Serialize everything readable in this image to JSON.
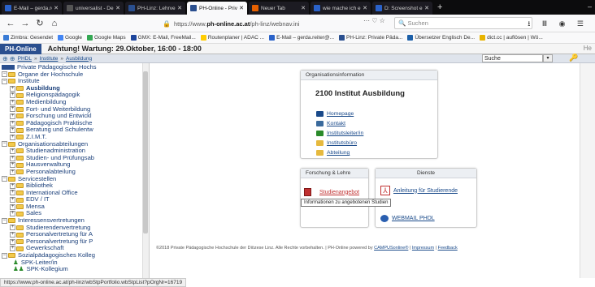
{
  "browser": {
    "tabs": [
      {
        "title": "E-Mail – gerda.reit",
        "color": "#2a62c9",
        "active": false
      },
      {
        "title": "universalist - Deuts",
        "color": "#555",
        "active": false
      },
      {
        "title": "PH-Linz: Lehrveran",
        "color": "#2a4f8f",
        "active": false
      },
      {
        "title": "PH-Online - Private",
        "color": "#2a4f8f",
        "active": true
      },
      {
        "title": "Neuer Tab",
        "color": "#e66000",
        "active": false
      },
      {
        "title": "wie mache ich einen",
        "color": "#2a62c9",
        "active": false
      },
      {
        "title": "D: Screenshot erstel",
        "color": "#2a62c9",
        "active": false
      }
    ],
    "url_prefix": "https://www.",
    "url_domain": "ph-online.ac.at",
    "url_path": "/ph-linz/webnav.ini",
    "url_more": "···",
    "search_placeholder": "Suchen",
    "bookmarks": [
      {
        "label": "Zimbra: Gesendet",
        "color": "#3a7bd5"
      },
      {
        "label": "Google",
        "color": "#4285f4"
      },
      {
        "label": "Google Maps",
        "color": "#34a853"
      },
      {
        "label": "GMX: E-Mail, FreeMail...",
        "color": "#1c449b"
      },
      {
        "label": "Routenplaner | ADAC ...",
        "color": "#ffcc00"
      },
      {
        "label": "E-Mail – gerda.reiter@...",
        "color": "#2a62c9"
      },
      {
        "label": "PH-Linz: Private Päda...",
        "color": "#2a4f8f"
      },
      {
        "label": "Übersetzer Englisch De...",
        "color": "#1c5fa8"
      },
      {
        "label": "dict.cc | auflösen | Wö...",
        "color": "#e8b400"
      }
    ],
    "status_url": "https://www.ph-online.ac.at/ph-linz/wbStpPortfolio.wbStpList?pOrgNr=16719"
  },
  "phonline": {
    "logo": "PH-Online",
    "warning_bold": "Achtung!",
    "warning_text": " Wartung: 29.Oktober, 16:00 - 18:00",
    "right_text": "He",
    "breadcrumb": [
      "PHDL",
      "Institute",
      "Ausbildung"
    ],
    "search_label": "Suche"
  },
  "tree": [
    {
      "label": "Private Pädagogische Hochs",
      "level": 0,
      "icon": "logo"
    },
    {
      "label": "Organe der Hochschule",
      "level": 1
    },
    {
      "label": "Institute",
      "level": 1
    },
    {
      "label": "Ausbildung",
      "level": 2,
      "bold": true
    },
    {
      "label": "Religionspädagogik",
      "level": 2
    },
    {
      "label": "Medienbildung",
      "level": 2
    },
    {
      "label": "Fort- und Weiterbildung",
      "level": 2
    },
    {
      "label": "Forschung und Entwickl",
      "level": 2
    },
    {
      "label": "Pädagogisch Praktische",
      "level": 2
    },
    {
      "label": "Beratung und Schulentw",
      "level": 2
    },
    {
      "label": "Z.I.M.T.",
      "level": 2
    },
    {
      "label": "Organisationsabteilungen",
      "level": 1
    },
    {
      "label": "Studienadministration",
      "level": 2
    },
    {
      "label": "Studien- und Prüfungsab",
      "level": 2
    },
    {
      "label": "Hausverwaltung",
      "level": 2
    },
    {
      "label": "Personalabteilung",
      "level": 2
    },
    {
      "label": "Servicestellen",
      "level": 1
    },
    {
      "label": "Bibliothek",
      "level": 2
    },
    {
      "label": "International Office",
      "level": 2
    },
    {
      "label": "EDV / IT",
      "level": 2
    },
    {
      "label": "Mensa",
      "level": 2
    },
    {
      "label": "Sales",
      "level": 2
    },
    {
      "label": "Interessensvertretungen",
      "level": 1
    },
    {
      "label": "Studierendenvertretung",
      "level": 2
    },
    {
      "label": "Personalvertretung für A",
      "level": 2
    },
    {
      "label": "Personalvertretung für P",
      "level": 2
    },
    {
      "label": "Gewerkschaft",
      "level": 2
    },
    {
      "label": "Sozialpädagogisches Kolleg",
      "level": 1
    },
    {
      "label": "SPK-Leiter/in",
      "level": 2,
      "icon": "person"
    },
    {
      "label": "SPK-Kollegium",
      "level": 2,
      "icon": "group"
    }
  ],
  "org": {
    "header": "Organisationsinformation",
    "title": "2100  Institut Ausbildung",
    "links": [
      {
        "label": "Homepage",
        "color": "#1a4a8a"
      },
      {
        "label": "Kontakt",
        "color": "#3a6a9c"
      },
      {
        "label": "Institutsleiter/in",
        "color": "#2a8a2a"
      },
      {
        "label": "Institutsbüro",
        "color": "#e6b93e"
      },
      {
        "label": "Abteilung",
        "color": "#e6b93e"
      }
    ]
  },
  "forschung": {
    "header": "Forschung & Lehre",
    "link": "Studienangebot"
  },
  "dienste": {
    "header": "Dienste",
    "link1": "Anleitung für Studierende",
    "link2": "WEBMAIL PHDL"
  },
  "tooltip": "Informationen zu angebotenen Studien",
  "footer": {
    "text": "©2018 Private Pädagogische Hochschule der Diözese Linz. Alle Rechte vorbehalten. | PH-Online powered by ",
    "link1": "CAMPUSonline®",
    "sep": " | ",
    "link2": "Impressum",
    "link3": "Feedback"
  }
}
